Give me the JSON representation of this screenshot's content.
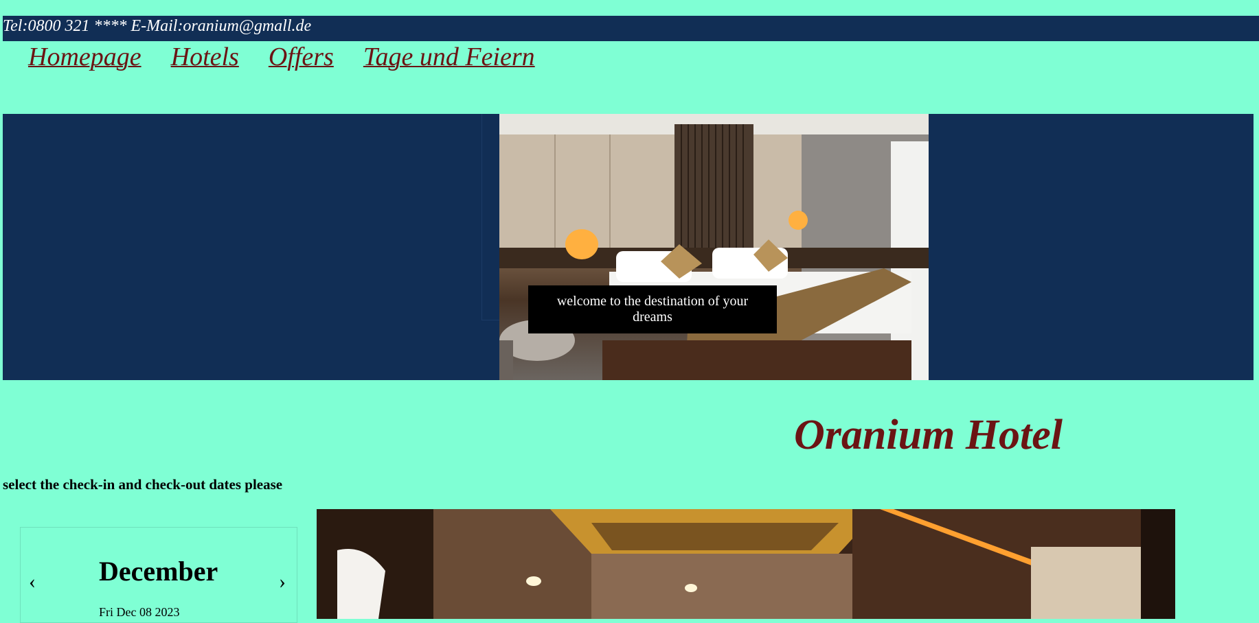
{
  "header": {
    "contact": "Tel:0800 321 **** E-Mail:oranium@gmall.de"
  },
  "nav": {
    "items": [
      "Homepage",
      "Hotels",
      "Offers",
      "Tage und Feiern"
    ]
  },
  "hero": {
    "welcome": "welcome to the destination of your dreams"
  },
  "main": {
    "title": "Oranium Hotel",
    "instruction": "select the check-in and check-out dates please"
  },
  "calendar": {
    "prev": "‹",
    "next": "›",
    "month": "December",
    "date": "Fri Dec 08 2023"
  },
  "colors": {
    "page_bg": "#7fffd4",
    "bar_bg": "#112e55",
    "accent": "#6b1414"
  }
}
